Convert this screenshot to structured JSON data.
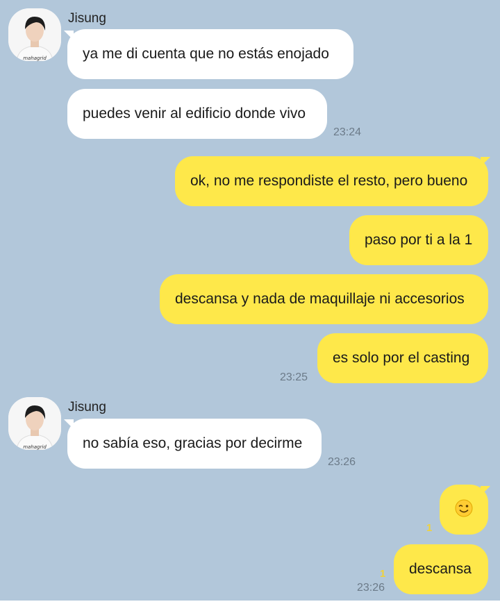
{
  "contact": {
    "name": "Jisung",
    "avatar_caption": "mahagrid"
  },
  "messages": [
    {
      "from": "contact",
      "text": "ya me di cuenta que no estás enojado"
    },
    {
      "from": "contact",
      "text": "puedes venir al edificio donde vivo",
      "time": "23:24"
    },
    {
      "from": "me",
      "text": "ok, no me respondiste el resto, pero bueno"
    },
    {
      "from": "me",
      "text": "paso por ti a la 1"
    },
    {
      "from": "me",
      "text": "descansa y nada de maquillaje ni accesorios"
    },
    {
      "from": "me",
      "text": "es solo por el casting",
      "time": "23:25"
    },
    {
      "from": "contact",
      "text": "no sabía eso, gracias por decirme",
      "time": "23:26"
    },
    {
      "from": "me",
      "emoji": "winking-face",
      "unread": "1"
    },
    {
      "from": "me",
      "text": "descansa",
      "unread": "1",
      "time": "23:26"
    }
  ],
  "colors": {
    "background": "#b2c7da",
    "incoming": "#ffffff",
    "outgoing": "#fee84a"
  }
}
